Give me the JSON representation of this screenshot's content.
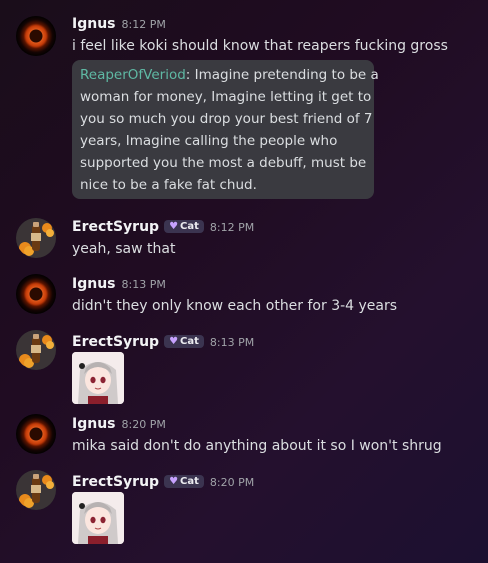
{
  "messages": [
    {
      "username": "Ignus",
      "time": "8:12 PM",
      "text": "i feel like koki should know that reapers fucking gross",
      "quote": {
        "author": "ReaperOfVeriod",
        "lines": [
          "Imagine pretending to be a",
          "woman for money, Imagine letting it get to",
          "you so much you drop your best friend of 7",
          "years, Imagine calling the people who",
          "supported you the most a debuff, must be",
          "nice to be a fake fat chud."
        ]
      }
    },
    {
      "username": "ErectSyrup",
      "tag": "Cat",
      "time": "8:12 PM",
      "text": "yeah, saw that"
    },
    {
      "username": "Ignus",
      "time": "8:13 PM",
      "text": "didn't they only know each other for 3-4 years"
    },
    {
      "username": "ErectSyrup",
      "tag": "Cat",
      "time": "8:13 PM",
      "sticker": "anime-girl-sticker"
    },
    {
      "username": "Ignus",
      "time": "8:20 PM",
      "text": "mika said don't do anything about it so I won't shrug"
    },
    {
      "username": "ErectSyrup",
      "tag": "Cat",
      "time": "8:20 PM",
      "sticker": "anime-girl-sticker"
    }
  ],
  "icons": {
    "tag_icon": "purple-heart-icon",
    "avatar_ignus": "fire-orb-avatar",
    "avatar_syrup": "syrup-bottle-avatar"
  },
  "colors": {
    "quote_author": "#5fb9a4",
    "tag_heart": "#c7a2ff",
    "background": "#200c22"
  }
}
